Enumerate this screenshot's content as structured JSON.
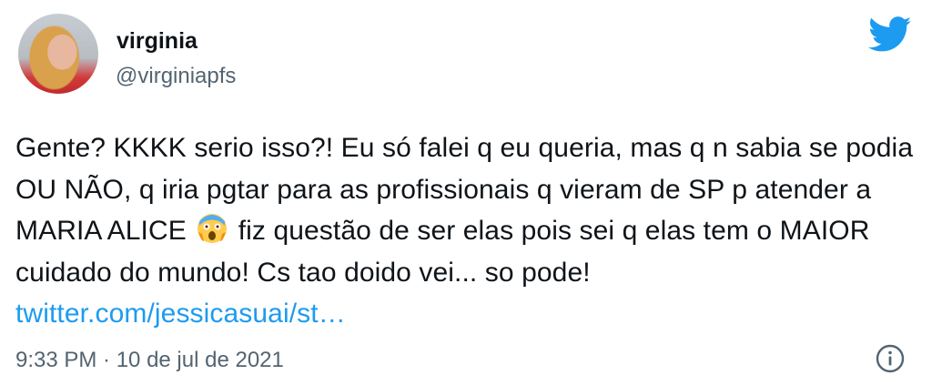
{
  "tweet": {
    "display_name": "virginia",
    "handle": "@virginiapfs",
    "text_part1": "Gente? KKKK serio isso?! Eu só falei q eu queria, mas q n sabia se podia OU NÃO, q iria pgtar para as profissionais q vieram de SP p atender a MARIA ALICE",
    "text_part2": "fiz questão de ser elas pois sei q elas tem o MAIOR cuidado do mundo! Cs tao doido vei... so pode!",
    "link_text": "twitter.com/jessicasuai/st…",
    "timestamp": "9:33 PM · 10 de jul de 2021",
    "emoji_name": "screaming-face-emoji"
  },
  "colors": {
    "brand": "#1d9bf0",
    "text": "#0f1419",
    "secondary": "#536471"
  },
  "icons": {
    "logo": "twitter-bird-icon",
    "info": "info-icon"
  }
}
